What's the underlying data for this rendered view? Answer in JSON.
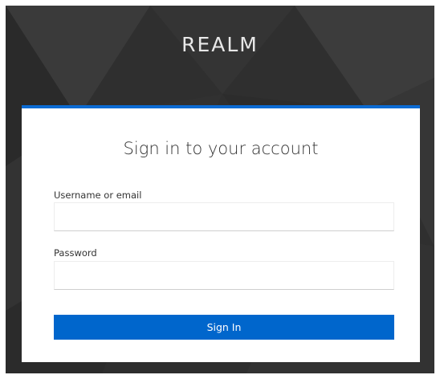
{
  "realm": {
    "title": "REALM"
  },
  "login": {
    "heading": "Sign in to your account",
    "username_label": "Username or email",
    "username_value": "",
    "password_label": "Password",
    "password_value": "",
    "submit_label": "Sign In"
  },
  "colors": {
    "accent": "#0066cc",
    "card_top_border": "#0b6bd3",
    "background": "#2f2f2f"
  }
}
